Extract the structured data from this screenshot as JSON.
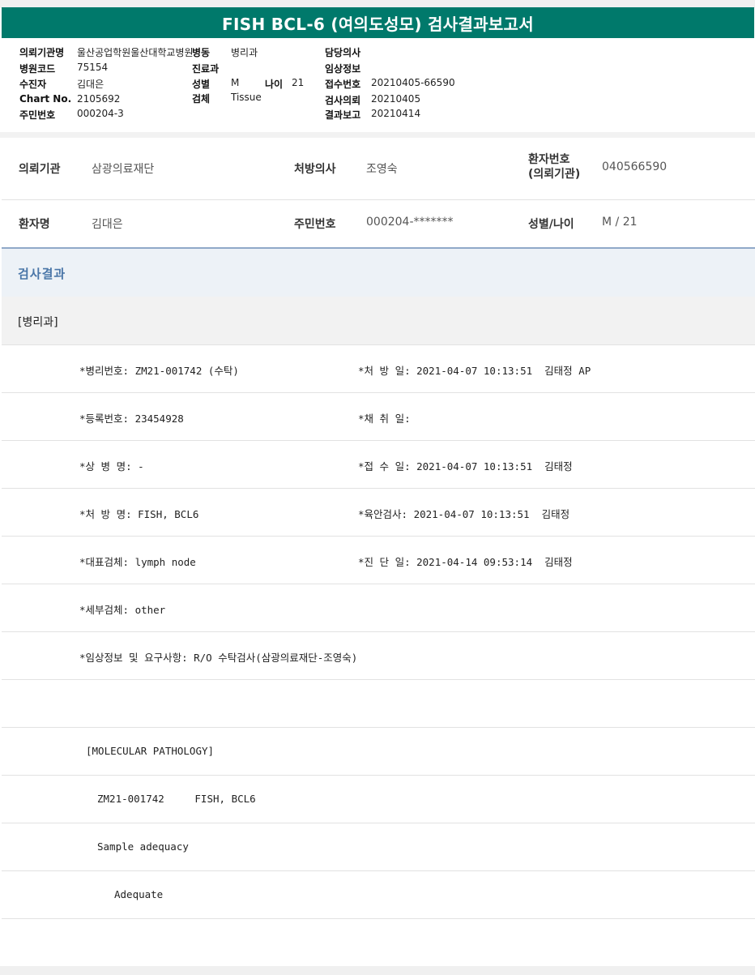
{
  "title": "FISH BCL-6 (여의도성모) 검사결과보고서",
  "header": {
    "institution_label": "의뢰기관명",
    "institution_value": "울산공업학원울산대학교병원",
    "ward_label": "병동",
    "ward_value": "병리과",
    "doctor_label": "담당의사",
    "doctor_value": "",
    "hospital_code_label": "병원코드",
    "hospital_code_value": "75154",
    "dept_label": "진료과",
    "dept_value": "",
    "clinical_label": "임상정보",
    "clinical_value": "",
    "examinee_label": "수진자",
    "examinee_value": "김대은",
    "sex_label": "성별",
    "sex_value": "M",
    "age_label": "나이",
    "age_value": "21",
    "accession_label": "접수번호",
    "accession_value": "20210405-66590",
    "chart_label": "Chart No.",
    "chart_value": "2105692",
    "specimen_label": "검체",
    "specimen_value": "Tissue",
    "request_label": "검사의뢰",
    "request_value": "20210405",
    "ssn_label": "주민번호",
    "ssn_value": "000204-3",
    "report_label": "결과보고",
    "report_value": "20210414"
  },
  "info": {
    "inst_label": "의뢰기관",
    "inst_value": "삼광의료재단",
    "presc_doctor_label": "처방의사",
    "presc_doctor_value": "조영숙",
    "patient_no_label_1": "환자번호",
    "patient_no_label_2": "(의뢰기관)",
    "patient_no_value": "040566590",
    "patient_name_label": "환자명",
    "patient_name_value": "김대은",
    "ssn_label": "주민번호",
    "ssn_value": "000204-*******",
    "sex_age_label": "성별/나이",
    "sex_age_value": "M / 21"
  },
  "section": {
    "title": "검사결과",
    "subtitle": "[병리과]"
  },
  "rows": [
    {
      "left": "*병리번호: ZM21-001742 (수탁)",
      "right": "*처 방 일: 2021-04-07 10:13:51  김태정 AP"
    },
    {
      "left": "*등록번호: 23454928",
      "right": "*채 취 일:"
    },
    {
      "left": "*상 병 명: -",
      "right": "*접 수 일: 2021-04-07 10:13:51  김태정"
    },
    {
      "left": "*처 방 명: FISH, BCL6",
      "right": "*육안검사: 2021-04-07 10:13:51  김태정"
    },
    {
      "left": "*대표검체: lymph node",
      "right": "*진 단 일: 2021-04-14 09:53:14  김태정"
    },
    {
      "left": "*세부검체: other",
      "right": ""
    },
    {
      "left": "*임상정보 및 요구사항: R/O 수탁검사(삼광의료재단-조영숙)",
      "right": ""
    },
    {
      "left": "",
      "right": ""
    },
    {
      "left": "[MOLECULAR PATHOLOGY]",
      "right": ""
    },
    {
      "left": "ZM21-001742     FISH, BCL6",
      "right": ""
    },
    {
      "left": "Sample adequacy",
      "right": ""
    },
    {
      "left": "Adequate",
      "right": ""
    }
  ]
}
